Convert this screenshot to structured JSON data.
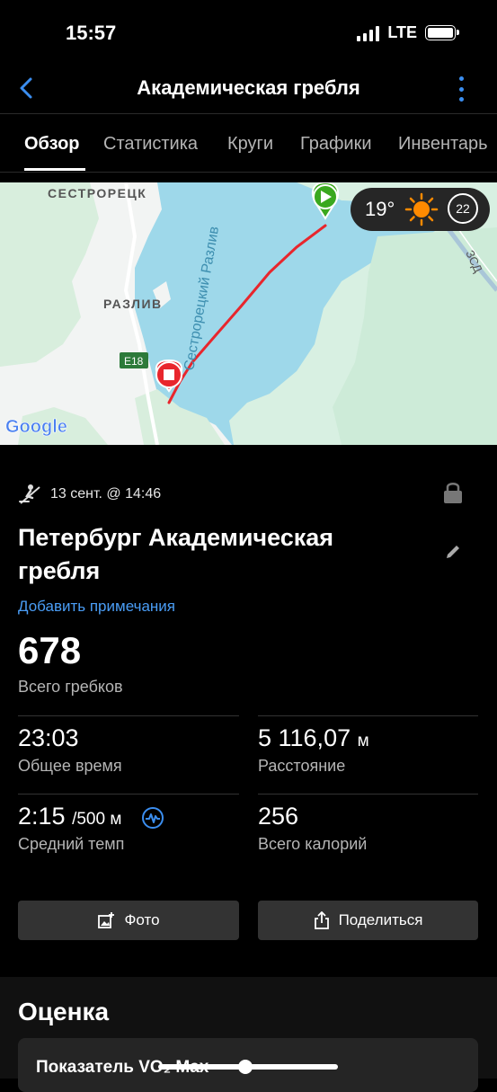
{
  "status": {
    "time": "15:57",
    "network": "LTE"
  },
  "nav": {
    "title": "Академическая гребля"
  },
  "tabs": [
    "Обзор",
    "Статистика",
    "Круги",
    "Графики",
    "Инвентарь"
  ],
  "map": {
    "labels": {
      "sestroretsk": "СЕСТРОРЕЦК",
      "razliv": "РАЗЛИВ",
      "water": "Сестрорецкий Разлив",
      "road": "E18",
      "zsd": "ЗСД",
      "google": "Google"
    },
    "weather": {
      "temperature": "19°",
      "wind": "22",
      "icon": "sun-icon"
    }
  },
  "activity": {
    "type_icon": "rowing-icon",
    "date": "13 сент. @ 14:46",
    "name": "Петербург Академическая гребля",
    "add_notes": "Добавить примечания",
    "total_strokes": "678",
    "total_strokes_label": "Всего гребков"
  },
  "stats": {
    "time": {
      "value": "23:03",
      "label": "Общее время"
    },
    "distance": {
      "value": "5 116,07",
      "unit": "м",
      "label": "Расстояние"
    },
    "pace": {
      "value": "2:15",
      "unit": "/500 м",
      "label": "Средний темп"
    },
    "calories": {
      "value": "256",
      "label": "Всего калорий"
    }
  },
  "actions": {
    "photo": "Фото",
    "share": "Поделиться"
  },
  "assessment": {
    "title": "Оценка",
    "vo2max": "Показатель VO₂ Max"
  },
  "colors": {
    "accent": "#3b8ef0",
    "link": "#4a9df5",
    "route": "#e8262d",
    "start": "#3aa81f",
    "stop": "#e8262d"
  }
}
